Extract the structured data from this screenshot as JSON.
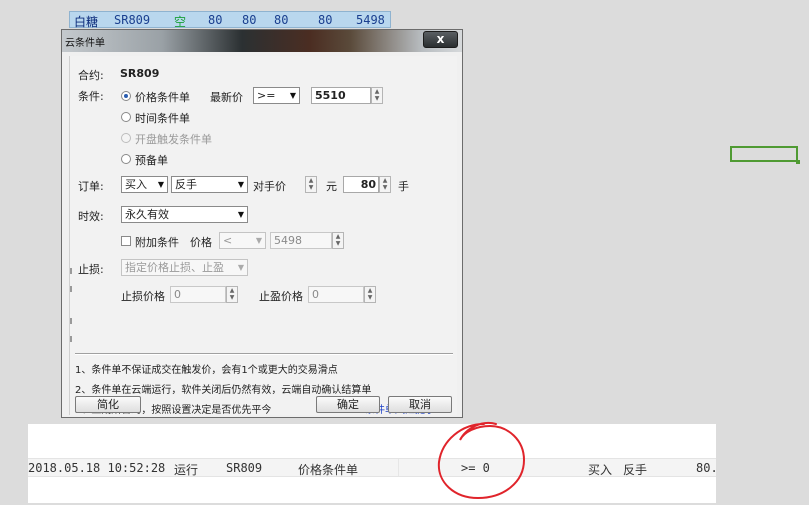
{
  "quote": {
    "name": "白糖",
    "code": "SR809",
    "direction": "空",
    "v1": "80",
    "v2": "80",
    "v3": "80",
    "v4": "80",
    "v5": "5498",
    "direction_color": "#1aa03a"
  },
  "dialog": {
    "title": "云条件单",
    "close_label": "x",
    "contract_label": "合约:",
    "contract_value": "SR809",
    "condition_label": "条件:",
    "condition_options": [
      {
        "label": "价格条件单",
        "selected": true,
        "enabled": true
      },
      {
        "label": "时间条件单",
        "selected": false,
        "enabled": true
      },
      {
        "label": "开盘触发条件单",
        "selected": false,
        "enabled": false
      },
      {
        "label": "预备单",
        "selected": false,
        "enabled": true
      }
    ],
    "latest_price_label": "最新价",
    "operator_value": ">=",
    "price_value": "5510",
    "order_label": "订单:",
    "side_value": "买入",
    "open_close_value": "反手",
    "counter_price_label": "对手价",
    "yuan_label": "元",
    "lots_value": "80",
    "lots_unit": "手",
    "validity_label": "时效:",
    "validity_value": "永久有效",
    "extra_condition_label": "附加条件",
    "extra_price_label": "价格",
    "extra_operator_value": "<",
    "extra_price_value": "5498",
    "stop_label": "止损:",
    "stop_select_value": "指定价格止损、止盈",
    "stop_loss_price_label": "止损价格",
    "stop_loss_price_value": "0",
    "take_profit_price_label": "止盈价格",
    "take_profit_price_value": "0",
    "notes": [
      "1、条件单不保证成交在触发价，会有1个或更大的交易滑点",
      "2、条件单在云端运行，软件关闭后仍然有效，云端自动确认结算单",
      "3、上期所合约，按照设置决定是否优先平今"
    ],
    "risk_link": "条件单风险提示",
    "simplify_button": "简化",
    "confirm_button": "确定",
    "cancel_button": "取消"
  },
  "order_row": {
    "time": "2018.05.18 10:52:28",
    "status": "运行",
    "code": "SR809",
    "type": "价格条件单",
    "condition": ">= 0",
    "side": "买入",
    "open_close": "反手",
    "price": "80."
  },
  "colors": {
    "annotation_circle": "#e0242b",
    "green_marker": "#4f9a32",
    "link": "#1a3fc8"
  }
}
